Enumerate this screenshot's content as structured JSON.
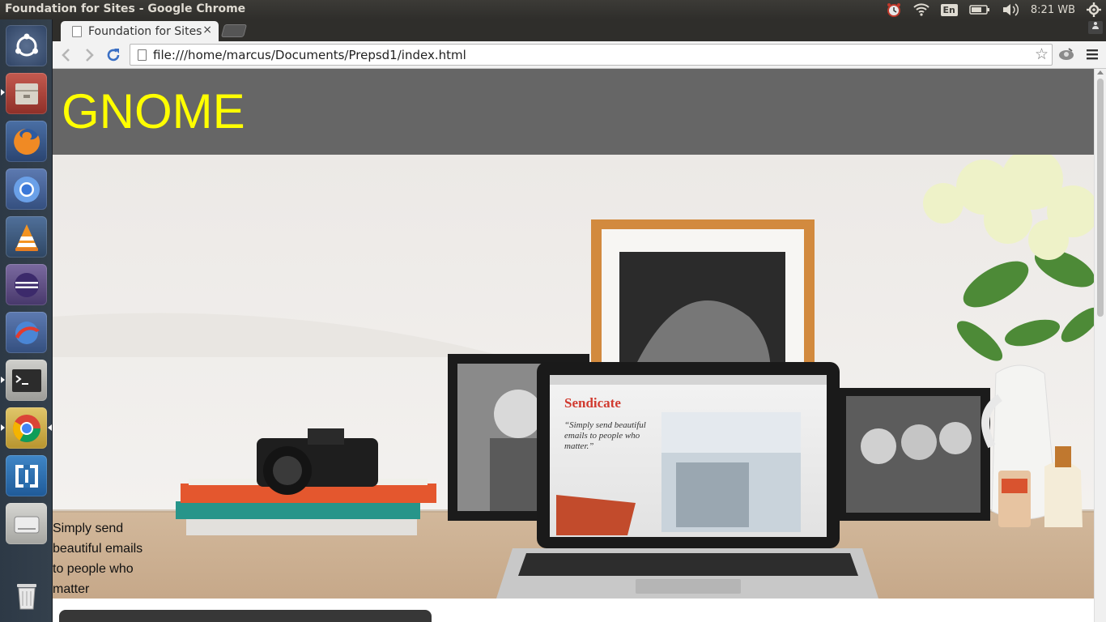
{
  "panel": {
    "window_title": "Foundation for Sites - Google Chrome",
    "language": "En",
    "clock": "8:21 WB"
  },
  "launcher": {
    "items": [
      "ubuntu-dash",
      "files",
      "firefox",
      "chromium",
      "vlc",
      "eclipse",
      "update-manager",
      "terminal",
      "google-chrome",
      "app",
      "disk",
      "trash"
    ]
  },
  "browser": {
    "tab_title": "Foundation for Sites",
    "tab_close": "×",
    "address": "file:///home/marcus/Documents/Prepsd1/index.html"
  },
  "page": {
    "brand": "GNOME",
    "tagline_lines": [
      "Simply send",
      "beautiful emails",
      "to people who",
      "matter"
    ],
    "screen_brand": "Sendicate",
    "screen_quote": "“Simply send beautiful emails to people who matter.”"
  },
  "colors": {
    "header_bg": "#666666",
    "brand": "#ffff00"
  }
}
